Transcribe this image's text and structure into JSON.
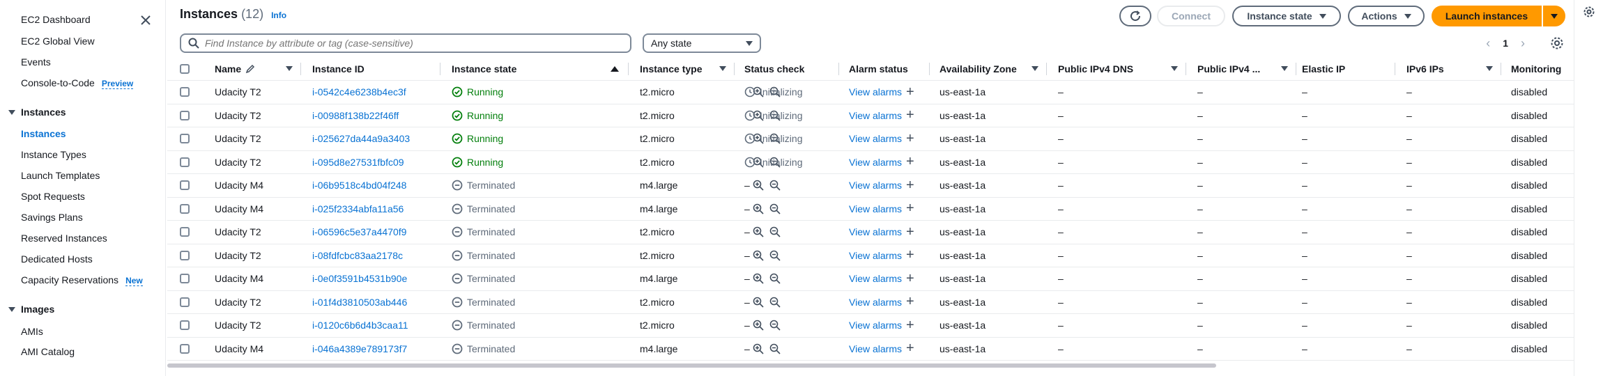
{
  "sidebar": {
    "top_items": [
      "EC2 Dashboard",
      "EC2 Global View",
      "Events",
      "Console-to-Code"
    ],
    "console_to_code_tag": "Preview",
    "instances_section": "Instances",
    "instances_items": [
      "Instances",
      "Instance Types",
      "Launch Templates",
      "Spot Requests",
      "Savings Plans",
      "Reserved Instances",
      "Dedicated Hosts",
      "Capacity Reservations"
    ],
    "capacity_tag": "New",
    "images_section": "Images",
    "images_items": [
      "AMIs",
      "AMI Catalog"
    ]
  },
  "header": {
    "title": "Instances",
    "count": "(12)",
    "info": "Info",
    "connect": "Connect",
    "instance_state": "Instance state",
    "actions": "Actions",
    "launch": "Launch instances"
  },
  "filter": {
    "search_placeholder": "Find Instance by attribute or tag (case-sensitive)",
    "state_select": "Any state",
    "page": "1"
  },
  "columns": [
    "Name",
    "Instance ID",
    "Instance state",
    "Instance type",
    "Status check",
    "Alarm status",
    "Availability Zone",
    "Public IPv4 DNS",
    "Public IPv4 ...",
    "Elastic IP",
    "IPv6 IPs",
    "Monitoring"
  ],
  "rows": [
    {
      "name": "Udacity T2",
      "id": "i-0542c4e6238b4ec3f",
      "state": "Running",
      "type": "t2.micro",
      "check": "Initializing",
      "alarm": "View alarms",
      "az": "us-east-1a",
      "dns": "–",
      "ipv4": "–",
      "eip": "–",
      "ipv6": "–",
      "mon": "disabled"
    },
    {
      "name": "Udacity T2",
      "id": "i-00988f138b22f46ff",
      "state": "Running",
      "type": "t2.micro",
      "check": "Initializing",
      "alarm": "View alarms",
      "az": "us-east-1a",
      "dns": "–",
      "ipv4": "–",
      "eip": "–",
      "ipv6": "–",
      "mon": "disabled"
    },
    {
      "name": "Udacity T2",
      "id": "i-025627da44a9a3403",
      "state": "Running",
      "type": "t2.micro",
      "check": "Initializing",
      "alarm": "View alarms",
      "az": "us-east-1a",
      "dns": "–",
      "ipv4": "–",
      "eip": "–",
      "ipv6": "–",
      "mon": "disabled"
    },
    {
      "name": "Udacity T2",
      "id": "i-095d8e27531fbfc09",
      "state": "Running",
      "type": "t2.micro",
      "check": "Initializing",
      "alarm": "View alarms",
      "az": "us-east-1a",
      "dns": "–",
      "ipv4": "–",
      "eip": "–",
      "ipv6": "–",
      "mon": "disabled"
    },
    {
      "name": "Udacity M4",
      "id": "i-06b9518c4bd04f248",
      "state": "Terminated",
      "type": "m4.large",
      "check": "–",
      "alarm": "View alarms",
      "az": "us-east-1a",
      "dns": "–",
      "ipv4": "–",
      "eip": "–",
      "ipv6": "–",
      "mon": "disabled"
    },
    {
      "name": "Udacity M4",
      "id": "i-025f2334abfa11a56",
      "state": "Terminated",
      "type": "m4.large",
      "check": "–",
      "alarm": "View alarms",
      "az": "us-east-1a",
      "dns": "–",
      "ipv4": "–",
      "eip": "–",
      "ipv6": "–",
      "mon": "disabled"
    },
    {
      "name": "Udacity T2",
      "id": "i-06596c5e37a4470f9",
      "state": "Terminated",
      "type": "t2.micro",
      "check": "–",
      "alarm": "View alarms",
      "az": "us-east-1a",
      "dns": "–",
      "ipv4": "–",
      "eip": "–",
      "ipv6": "–",
      "mon": "disabled"
    },
    {
      "name": "Udacity T2",
      "id": "i-08fdfcbc83aa2178c",
      "state": "Terminated",
      "type": "t2.micro",
      "check": "–",
      "alarm": "View alarms",
      "az": "us-east-1a",
      "dns": "–",
      "ipv4": "–",
      "eip": "–",
      "ipv6": "–",
      "mon": "disabled"
    },
    {
      "name": "Udacity M4",
      "id": "i-0e0f3591b4531b90e",
      "state": "Terminated",
      "type": "m4.large",
      "check": "–",
      "alarm": "View alarms",
      "az": "us-east-1a",
      "dns": "–",
      "ipv4": "–",
      "eip": "–",
      "ipv6": "–",
      "mon": "disabled"
    },
    {
      "name": "Udacity T2",
      "id": "i-01f4d3810503ab446",
      "state": "Terminated",
      "type": "t2.micro",
      "check": "–",
      "alarm": "View alarms",
      "az": "us-east-1a",
      "dns": "–",
      "ipv4": "–",
      "eip": "–",
      "ipv6": "–",
      "mon": "disabled"
    },
    {
      "name": "Udacity T2",
      "id": "i-0120c6b6d4b3caa11",
      "state": "Terminated",
      "type": "t2.micro",
      "check": "–",
      "alarm": "View alarms",
      "az": "us-east-1a",
      "dns": "–",
      "ipv4": "–",
      "eip": "–",
      "ipv6": "–",
      "mon": "disabled"
    },
    {
      "name": "Udacity M4",
      "id": "i-046a4389e789173f7",
      "state": "Terminated",
      "type": "m4.large",
      "check": "–",
      "alarm": "View alarms",
      "az": "us-east-1a",
      "dns": "–",
      "ipv4": "–",
      "eip": "–",
      "ipv6": "–",
      "mon": "disabled"
    }
  ],
  "colors": {
    "accent": "#0972d3",
    "primary": "#ff9900",
    "running": "#037f0c",
    "muted": "#5f6b7a"
  }
}
